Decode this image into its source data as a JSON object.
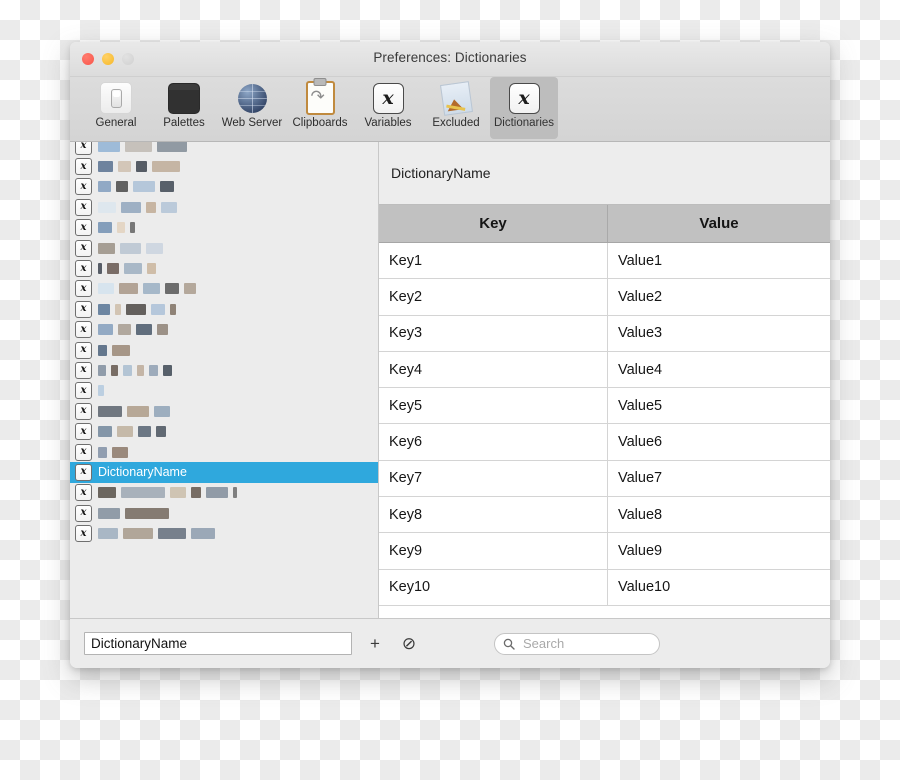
{
  "window": {
    "title": "Preferences: Dictionaries",
    "traffic_lights": [
      "close",
      "minimize",
      "zoom-disabled"
    ]
  },
  "toolbar": {
    "items": [
      {
        "label": "General",
        "icon": "toggle-switch-icon",
        "selected": false
      },
      {
        "label": "Palettes",
        "icon": "dark-window-icon",
        "selected": false
      },
      {
        "label": "Web Server",
        "icon": "globe-icon",
        "selected": false
      },
      {
        "label": "Clipboards",
        "icon": "clipboard-icon",
        "selected": false
      },
      {
        "label": "Variables",
        "icon": "script-x-icon",
        "selected": false
      },
      {
        "label": "Excluded",
        "icon": "app-tilted-icon",
        "selected": false
      },
      {
        "label": "Dictionaries",
        "icon": "script-x-icon",
        "selected": true
      }
    ]
  },
  "sidebar": {
    "badge_glyph": "x",
    "selected_index": 16,
    "items": [
      {
        "label": "",
        "redacted": true,
        "blocks": [
          [
            22,
            "#7fa8d0"
          ],
          [
            27,
            "#b7b0a8"
          ],
          [
            30,
            "#6e7a86"
          ]
        ]
      },
      {
        "label": "",
        "redacted": true,
        "blocks": [
          [
            15,
            "#3d5a80"
          ],
          [
            13,
            "#c9b7a4"
          ],
          [
            11,
            "#1c2430"
          ],
          [
            28,
            "#b59f88"
          ]
        ]
      },
      {
        "label": "",
        "redacted": true,
        "blocks": [
          [
            13,
            "#6d8fb5"
          ],
          [
            12,
            "#2b2b2b"
          ],
          [
            22,
            "#9fb8d2"
          ],
          [
            14,
            "#1f2a38"
          ]
        ]
      },
      {
        "label": "",
        "redacted": true,
        "blocks": [
          [
            18,
            "#d8e4ef"
          ],
          [
            20,
            "#7f98b4"
          ],
          [
            10,
            "#b99f85"
          ],
          [
            16,
            "#a8bcd2"
          ]
        ]
      },
      {
        "label": "",
        "redacted": true,
        "blocks": [
          [
            14,
            "#5b7fa8"
          ],
          [
            8,
            "#e0cdb6"
          ],
          [
            5,
            "#4a4a4a"
          ]
        ]
      },
      {
        "label": "",
        "redacted": true,
        "blocks": [
          [
            17,
            "#8a7f72"
          ],
          [
            21,
            "#aebdcc"
          ],
          [
            17,
            "#c3cfdc"
          ]
        ]
      },
      {
        "label": "",
        "redacted": true,
        "blocks": [
          [
            4,
            "#1d2633"
          ],
          [
            12,
            "#4d3c33"
          ],
          [
            18,
            "#8fa3b8"
          ],
          [
            9,
            "#c4ab8e"
          ]
        ]
      },
      {
        "label": "",
        "redacted": true,
        "blocks": [
          [
            16,
            "#cfe0ef"
          ],
          [
            19,
            "#9b8673"
          ],
          [
            17,
            "#8ba3bb"
          ],
          [
            14,
            "#3a3a3a"
          ],
          [
            12,
            "#9e8d7c"
          ]
        ]
      },
      {
        "label": "",
        "redacted": true,
        "blocks": [
          [
            12,
            "#3b5e85"
          ],
          [
            6,
            "#c7b49c"
          ],
          [
            20,
            "#2f2a26"
          ],
          [
            14,
            "#9fb9d4"
          ],
          [
            6,
            "#6b5a4a"
          ]
        ]
      },
      {
        "label": "",
        "redacted": true,
        "blocks": [
          [
            15,
            "#7090b4"
          ],
          [
            13,
            "#9a8d80"
          ],
          [
            16,
            "#2b3d52"
          ],
          [
            11,
            "#7d6e5f"
          ]
        ]
      },
      {
        "label": "",
        "redacted": true,
        "blocks": [
          [
            9,
            "#2f4a68"
          ],
          [
            18,
            "#8a7460"
          ]
        ]
      },
      {
        "label": "",
        "redacted": true,
        "blocks": [
          [
            8,
            "#6c7d90"
          ],
          [
            7,
            "#4b3b30"
          ],
          [
            9,
            "#9cb4cb"
          ],
          [
            7,
            "#b4a08a"
          ],
          [
            9,
            "#7e92a8"
          ],
          [
            9,
            "#1d2937"
          ]
        ]
      },
      {
        "label": "",
        "redacted": true,
        "blocks": [
          [
            6,
            "#a9c4dd"
          ]
        ]
      },
      {
        "label": "",
        "redacted": true,
        "blocks": [
          [
            24,
            "#404a56"
          ],
          [
            22,
            "#a28d76"
          ],
          [
            16,
            "#7e95ad"
          ]
        ]
      },
      {
        "label": "",
        "redacted": true,
        "blocks": [
          [
            14,
            "#5c748d"
          ],
          [
            16,
            "#b6a58f"
          ],
          [
            13,
            "#3a4a5c"
          ],
          [
            10,
            "#2b3644"
          ]
        ]
      },
      {
        "label": "",
        "redacted": true,
        "blocks": [
          [
            9,
            "#6d8098"
          ],
          [
            16,
            "#7a6250"
          ]
        ]
      },
      {
        "label": "DictionaryName",
        "redacted": false,
        "blocks": []
      },
      {
        "label": "",
        "redacted": true,
        "blocks": [
          [
            18,
            "#3a3228"
          ],
          [
            44,
            "#8e9aa8"
          ],
          [
            16,
            "#c3b49c"
          ],
          [
            10,
            "#4a3a2e"
          ],
          [
            22,
            "#6e7c8c"
          ],
          [
            4,
            "#555"
          ]
        ]
      },
      {
        "label": "",
        "redacted": true,
        "blocks": [
          [
            22,
            "#6d7d8e"
          ],
          [
            44,
            "#5d4f42"
          ]
        ]
      },
      {
        "label": "",
        "redacted": true,
        "blocks": [
          [
            20,
            "#8fa2b6"
          ],
          [
            30,
            "#9a8a78"
          ],
          [
            28,
            "#4a5666"
          ],
          [
            24,
            "#7b8ea2"
          ]
        ]
      }
    ]
  },
  "detail": {
    "title": "DictionaryName",
    "table": {
      "columns": [
        "Key",
        "Value"
      ],
      "rows": [
        [
          "Key1",
          "Value1"
        ],
        [
          "Key2",
          "Value2"
        ],
        [
          "Key3",
          "Value3"
        ],
        [
          "Key4",
          "Value4"
        ],
        [
          "Key5",
          "Value5"
        ],
        [
          "Key6",
          "Value6"
        ],
        [
          "Key7",
          "Value7"
        ],
        [
          "Key8",
          "Value8"
        ],
        [
          "Key9",
          "Value9"
        ],
        [
          "Key10",
          "Value10"
        ]
      ]
    }
  },
  "footer": {
    "name_value": "DictionaryName",
    "add_button": "+",
    "disable_button": "⊘",
    "search_placeholder": "Search",
    "search_value": "",
    "search_icon": "magnifier-icon"
  },
  "colors": {
    "selection_blue": "#2fa8dd",
    "toolbar_selected": "#bdbdbd",
    "table_header": "#c1c1c1"
  }
}
